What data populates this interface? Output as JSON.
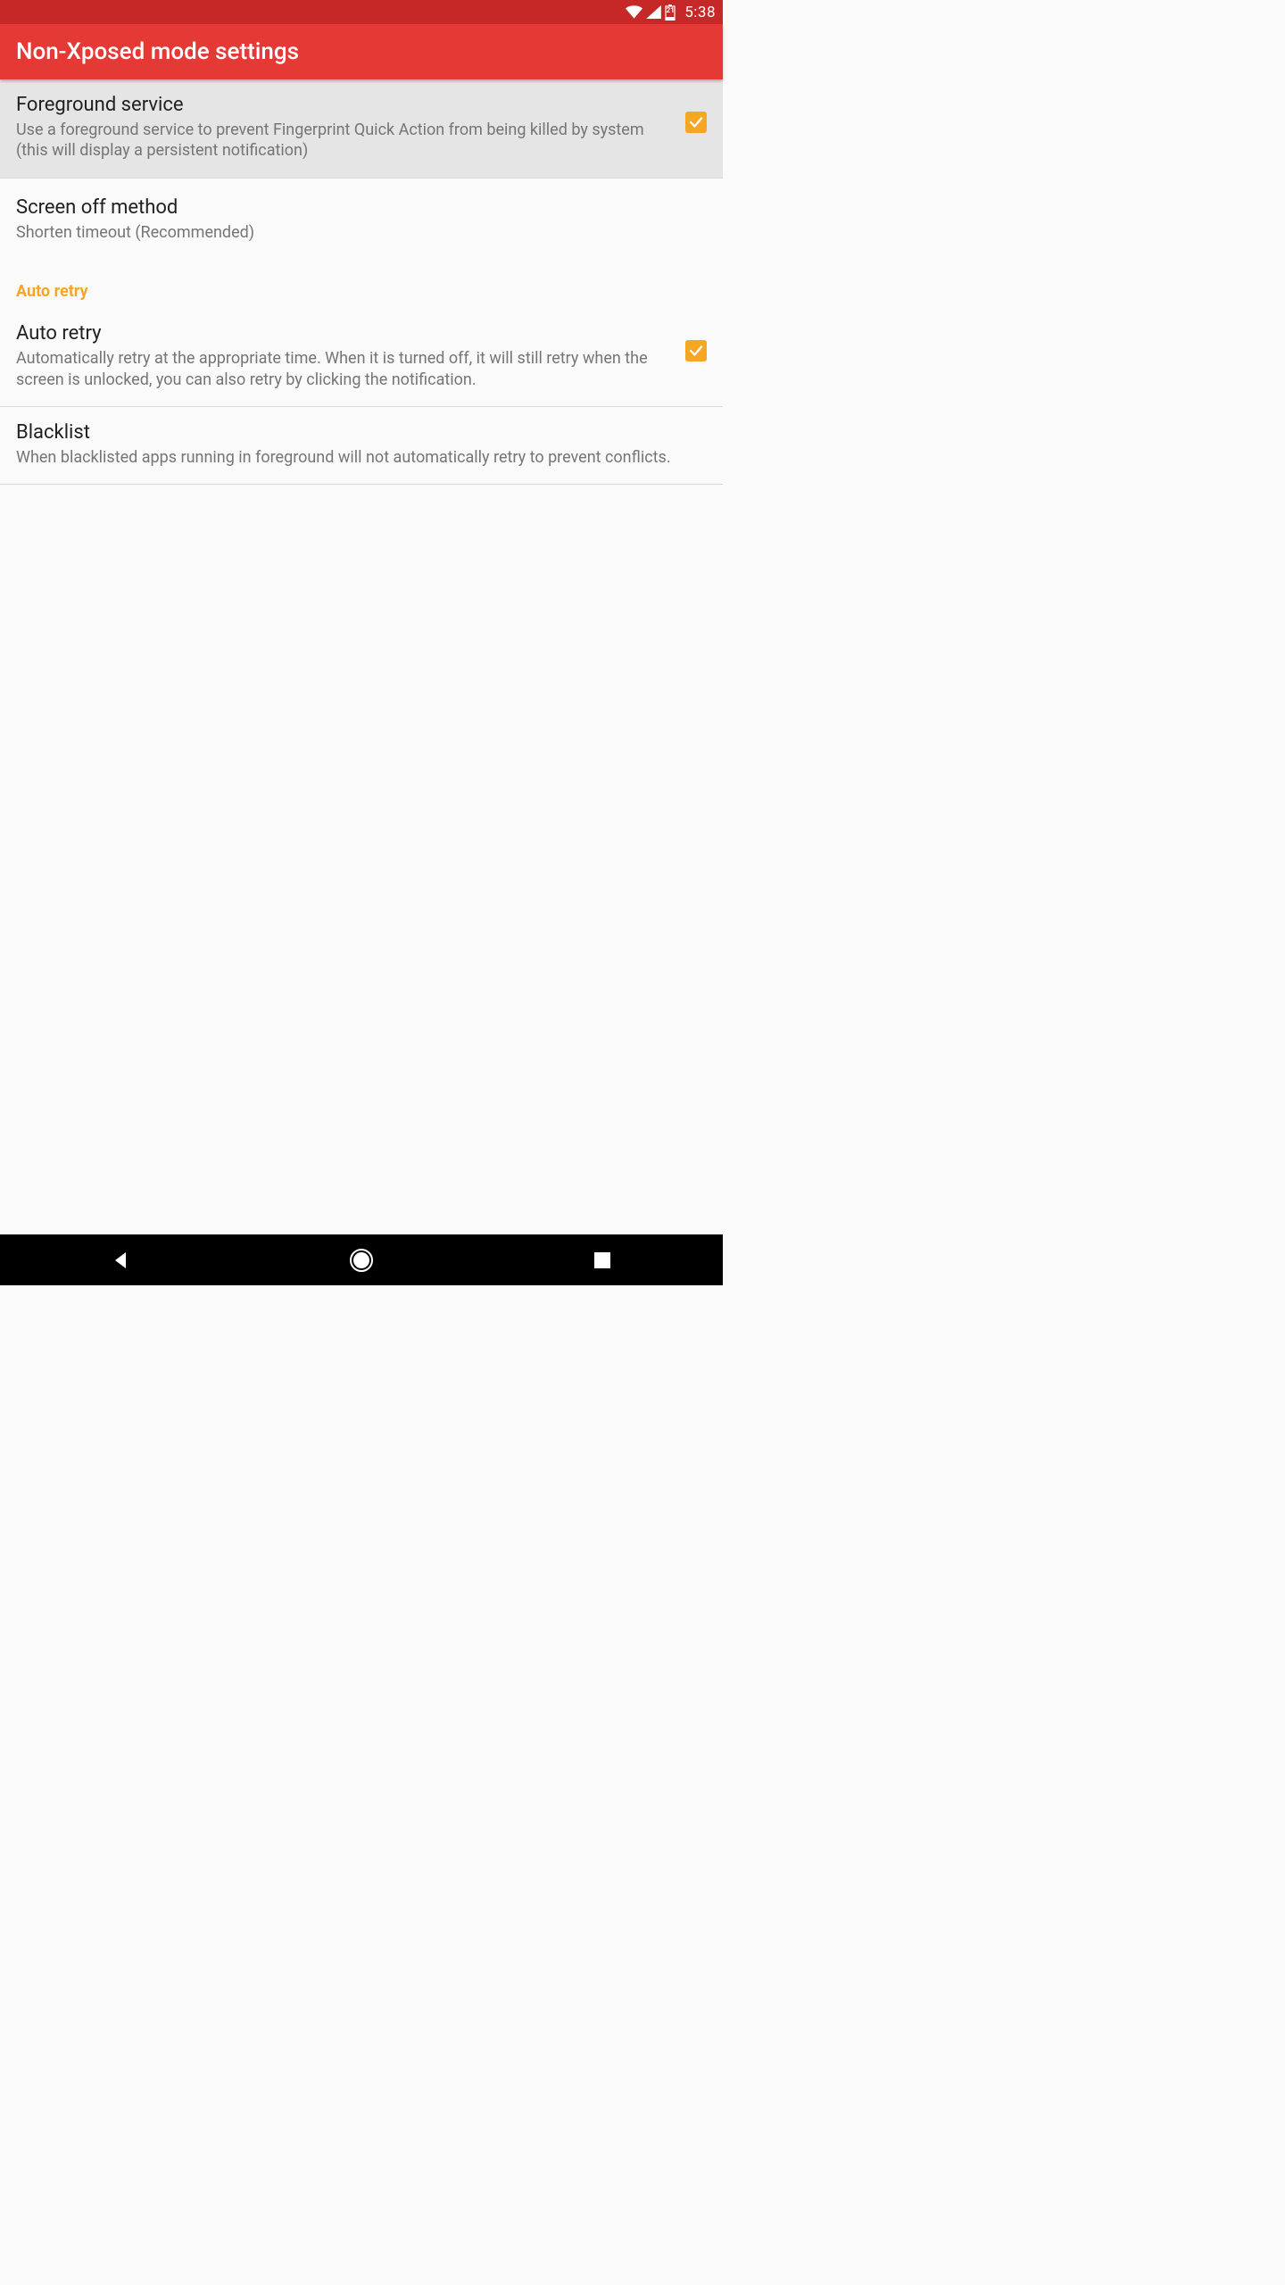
{
  "status_bar": {
    "battery_level": "21",
    "time": "5:38"
  },
  "app_bar": {
    "title": "Non-Xposed mode settings"
  },
  "prefs": {
    "foreground_service": {
      "title": "Foreground service",
      "summary": "Use a foreground service to prevent Fingerprint Quick Action from being killed by system (this will display a persistent notification)",
      "checked": true
    },
    "screen_off_method": {
      "title": "Screen off method",
      "summary": "Shorten timeout (Recommended)"
    },
    "category_auto_retry": {
      "label": "Auto retry"
    },
    "auto_retry": {
      "title": "Auto retry",
      "summary": "Automatically retry at the appropriate time. When it is turned off, it will still retry when the screen is unlocked, you can also retry by clicking the notification.",
      "checked": true
    },
    "blacklist": {
      "title": "Blacklist",
      "summary": "When blacklisted apps running in foreground will not automatically retry to prevent conflicts."
    }
  },
  "colors": {
    "status_bar_bg": "#c62828",
    "app_bar_bg": "#e53935",
    "accent": "#f5a623",
    "text_primary": "#212121",
    "text_secondary": "#757575"
  }
}
